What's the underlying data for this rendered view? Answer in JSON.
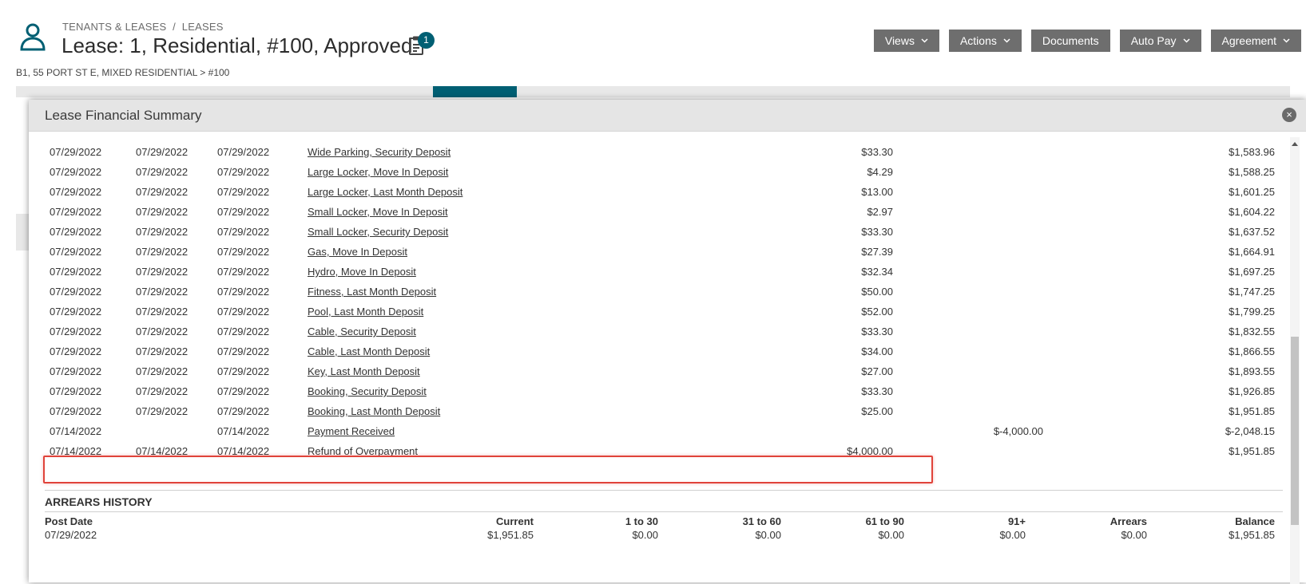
{
  "breadcrumb": {
    "section": "TENANTS & LEASES",
    "separator": "/",
    "page": "LEASES"
  },
  "page_title": "Lease: 1, Residential, #100, Approved",
  "notes_badge": "1",
  "property_path": "B1, 55 PORT ST E, MIXED RESIDENTIAL > #100",
  "toolbar": {
    "views": "Views",
    "actions": "Actions",
    "documents": "Documents",
    "auto_pay": "Auto Pay",
    "agreement": "Agreement"
  },
  "modal": {
    "title": "Lease Financial Summary",
    "close": "×"
  },
  "ledger": {
    "rows": [
      {
        "d1": "07/29/2022",
        "d2": "07/29/2022",
        "d3": "07/29/2022",
        "desc": "Wide Parking, Security Deposit",
        "charge": "$33.30",
        "payment": "",
        "balance": "$1,583.96"
      },
      {
        "d1": "07/29/2022",
        "d2": "07/29/2022",
        "d3": "07/29/2022",
        "desc": "Large Locker, Move In Deposit",
        "charge": "$4.29",
        "payment": "",
        "balance": "$1,588.25"
      },
      {
        "d1": "07/29/2022",
        "d2": "07/29/2022",
        "d3": "07/29/2022",
        "desc": "Large Locker, Last Month Deposit",
        "charge": "$13.00",
        "payment": "",
        "balance": "$1,601.25"
      },
      {
        "d1": "07/29/2022",
        "d2": "07/29/2022",
        "d3": "07/29/2022",
        "desc": "Small Locker, Move In Deposit",
        "charge": "$2.97",
        "payment": "",
        "balance": "$1,604.22"
      },
      {
        "d1": "07/29/2022",
        "d2": "07/29/2022",
        "d3": "07/29/2022",
        "desc": "Small Locker, Security Deposit",
        "charge": "$33.30",
        "payment": "",
        "balance": "$1,637.52"
      },
      {
        "d1": "07/29/2022",
        "d2": "07/29/2022",
        "d3": "07/29/2022",
        "desc": "Gas, Move In Deposit",
        "charge": "$27.39",
        "payment": "",
        "balance": "$1,664.91"
      },
      {
        "d1": "07/29/2022",
        "d2": "07/29/2022",
        "d3": "07/29/2022",
        "desc": "Hydro, Move In Deposit",
        "charge": "$32.34",
        "payment": "",
        "balance": "$1,697.25"
      },
      {
        "d1": "07/29/2022",
        "d2": "07/29/2022",
        "d3": "07/29/2022",
        "desc": "Fitness, Last Month Deposit",
        "charge": "$50.00",
        "payment": "",
        "balance": "$1,747.25"
      },
      {
        "d1": "07/29/2022",
        "d2": "07/29/2022",
        "d3": "07/29/2022",
        "desc": "Pool, Last Month Deposit",
        "charge": "$52.00",
        "payment": "",
        "balance": "$1,799.25"
      },
      {
        "d1": "07/29/2022",
        "d2": "07/29/2022",
        "d3": "07/29/2022",
        "desc": "Cable, Security Deposit",
        "charge": "$33.30",
        "payment": "",
        "balance": "$1,832.55"
      },
      {
        "d1": "07/29/2022",
        "d2": "07/29/2022",
        "d3": "07/29/2022",
        "desc": "Cable, Last Month Deposit",
        "charge": "$34.00",
        "payment": "",
        "balance": "$1,866.55"
      },
      {
        "d1": "07/29/2022",
        "d2": "07/29/2022",
        "d3": "07/29/2022",
        "desc": "Key, Last Month Deposit",
        "charge": "$27.00",
        "payment": "",
        "balance": "$1,893.55"
      },
      {
        "d1": "07/29/2022",
        "d2": "07/29/2022",
        "d3": "07/29/2022",
        "desc": "Booking, Security Deposit",
        "charge": "$33.30",
        "payment": "",
        "balance": "$1,926.85"
      },
      {
        "d1": "07/29/2022",
        "d2": "07/29/2022",
        "d3": "07/29/2022",
        "desc": "Booking, Last Month Deposit",
        "charge": "$25.00",
        "payment": "",
        "balance": "$1,951.85"
      },
      {
        "d1": "07/14/2022",
        "d2": "",
        "d3": "07/14/2022",
        "desc": "Payment Received",
        "charge": "",
        "payment": "$-4,000.00",
        "balance": "$-2,048.15"
      },
      {
        "d1": "07/14/2022",
        "d2": "07/14/2022",
        "d3": "07/14/2022",
        "desc": "Refund of Overpayment",
        "charge": "$4,000.00",
        "payment": "",
        "balance": "$1,951.85"
      }
    ]
  },
  "arrears": {
    "title": "ARREARS HISTORY",
    "headers": {
      "post_date": "Post Date",
      "current": "Current",
      "d1_30": "1 to 30",
      "d31_60": "31 to 60",
      "d61_90": "61 to 90",
      "d91": "91+",
      "arrears": "Arrears",
      "balance": "Balance"
    },
    "row": {
      "post_date": "07/29/2022",
      "current": "$1,951.85",
      "d1_30": "$0.00",
      "d31_60": "$0.00",
      "d61_90": "$0.00",
      "d91": "$0.00",
      "arrears": "$0.00",
      "balance": "$1,951.85"
    }
  },
  "colors": {
    "accent": "#005f73",
    "button": "#6e6e6e",
    "highlight": "#e0433a"
  }
}
